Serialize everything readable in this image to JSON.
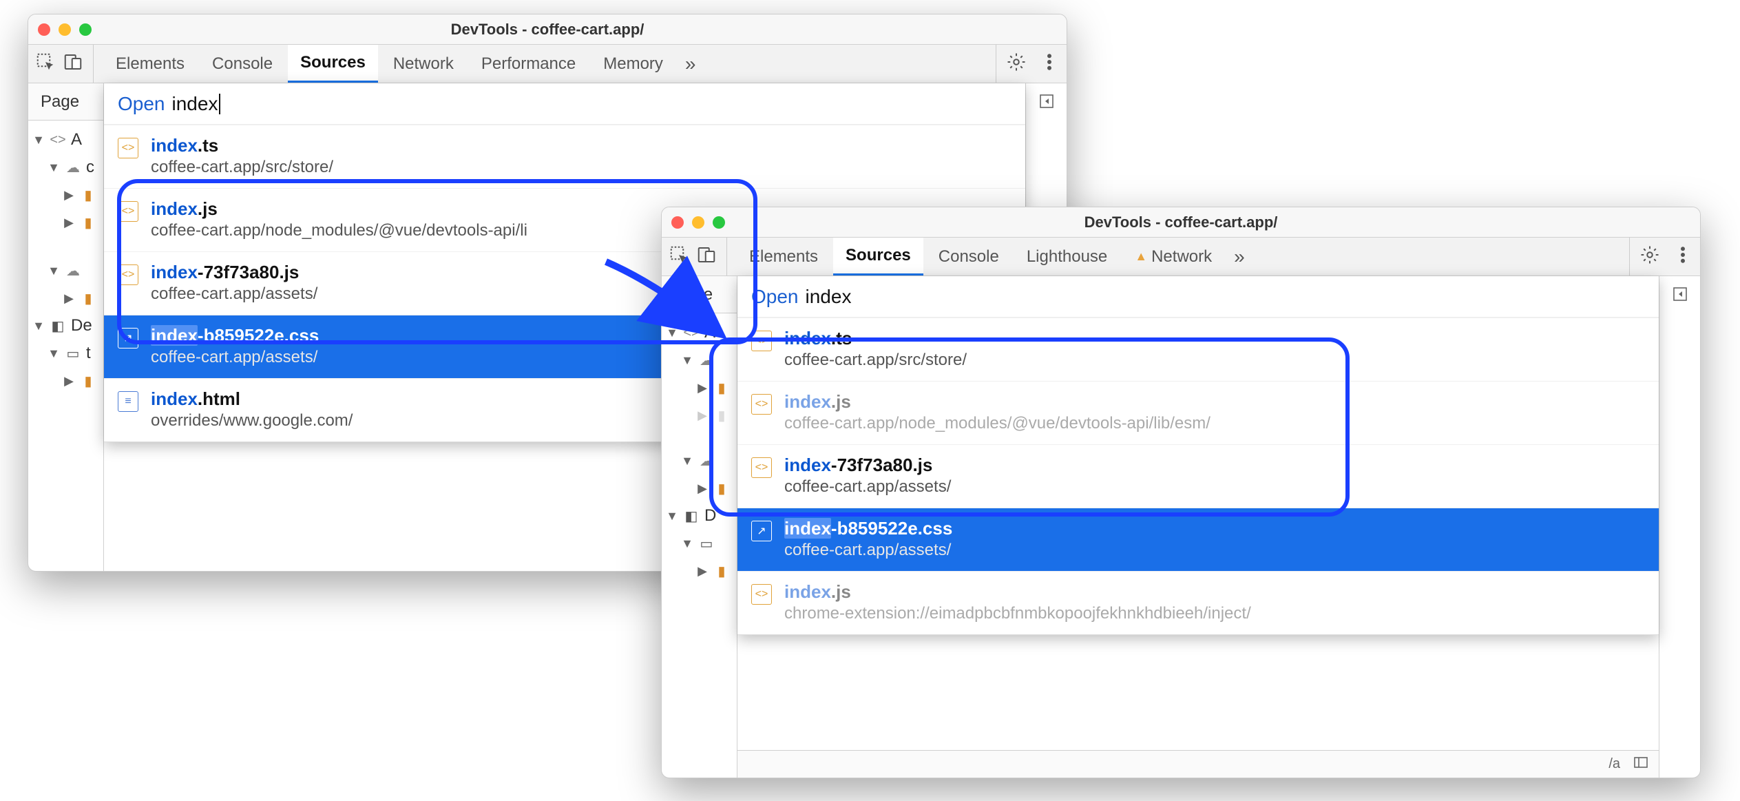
{
  "windowA": {
    "title": "DevTools - coffee-cart.app/",
    "tabs": [
      "Elements",
      "Console",
      "Sources",
      "Network",
      "Performance",
      "Memory"
    ],
    "active_tab": "Sources",
    "page_tab": "Page",
    "tree": {
      "l0": "A",
      "l1_cloud": "c",
      "l3_label": "De",
      "l4_label": "t"
    },
    "quickopen": {
      "command": "Open",
      "query": "index",
      "items": [
        {
          "match": "index",
          "rest": ".ts",
          "path": "coffee-cart.app/src/store/",
          "icon": "js"
        },
        {
          "match": "index",
          "rest": ".js",
          "path": "coffee-cart.app/node_modules/@vue/devtools-api/li",
          "icon": "js"
        },
        {
          "match": "index",
          "rest": "-73f73a80.js",
          "path": "coffee-cart.app/assets/",
          "icon": "js"
        },
        {
          "match": "index",
          "rest": "-b859522e.css",
          "path": "coffee-cart.app/assets/",
          "icon": "css",
          "selected": true,
          "hl": true
        },
        {
          "match": "index",
          "rest": ".html",
          "path": "overrides/www.google.com/",
          "icon": "html"
        }
      ]
    }
  },
  "windowB": {
    "title": "DevTools - coffee-cart.app/",
    "tabs": [
      "Elements",
      "Sources",
      "Console",
      "Lighthouse",
      "Network"
    ],
    "active_tab": "Sources",
    "warn_tab": "Network",
    "page_tab": "Page",
    "tree": {
      "l0": "A",
      "l3_label": "D",
      "status_tail": "/a"
    },
    "quickopen": {
      "command": "Open",
      "query": "index",
      "items": [
        {
          "match": "index",
          "rest": ".ts",
          "path": "coffee-cart.app/src/store/",
          "icon": "js"
        },
        {
          "match": "index",
          "rest": ".js",
          "path": "coffee-cart.app/node_modules/@vue/devtools-api/lib/esm/",
          "icon": "js",
          "dim": true
        },
        {
          "match": "index",
          "rest": "-73f73a80.js",
          "path": "coffee-cart.app/assets/",
          "icon": "js"
        },
        {
          "match": "index",
          "rest": "-b859522e.css",
          "path": "coffee-cart.app/assets/",
          "icon": "css",
          "selected": true,
          "hl": true
        },
        {
          "match": "index",
          "rest": ".js",
          "path": "chrome-extension://eimadpbcbfnmbkopoojfekhnkhdbieeh/inject/",
          "icon": "js",
          "dim": true
        }
      ]
    }
  }
}
